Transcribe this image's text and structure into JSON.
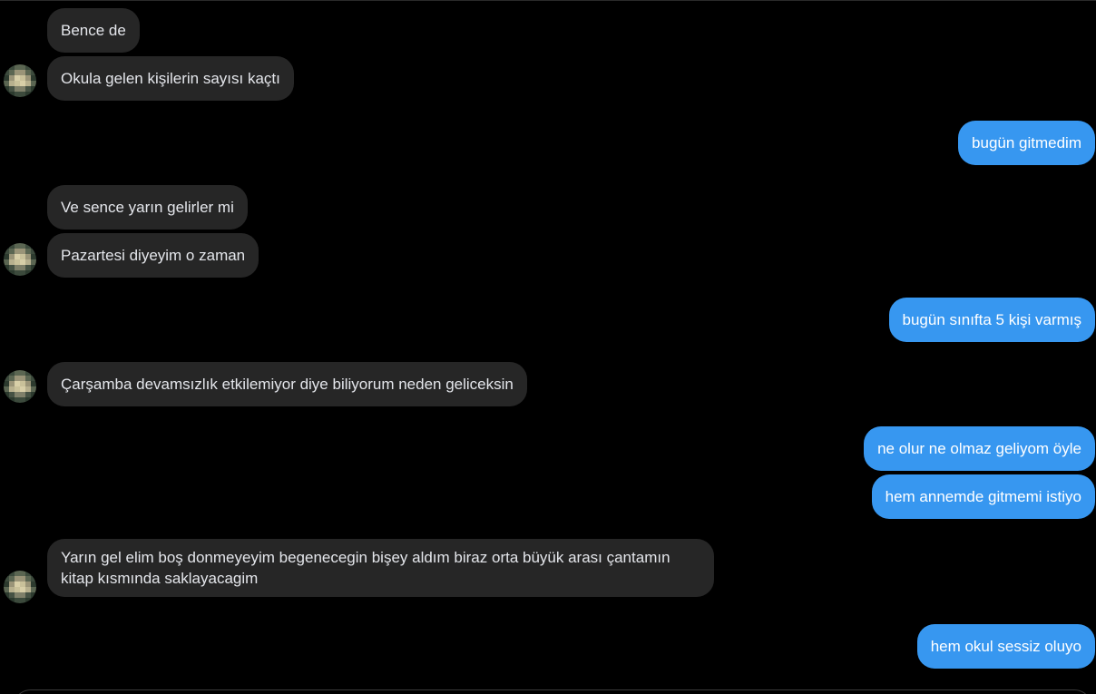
{
  "conversation": {
    "messages": [
      {
        "side": "in",
        "text": "Bence de"
      },
      {
        "side": "in",
        "text": "Okula gelen kişilerin sayısı kaçtı"
      },
      {
        "side": "out",
        "text": "bugün gitmedim"
      },
      {
        "side": "in",
        "text": "Ve sence yarın gelirler mi"
      },
      {
        "side": "in",
        "text": "Pazartesi diyeyim o zaman"
      },
      {
        "side": "out",
        "text": "bugün sınıfta 5 kişi varmış"
      },
      {
        "side": "in",
        "text": "Çarşamba devamsızlık etkilemiyor diye biliyorum neden geliceksin"
      },
      {
        "side": "out",
        "text": "ne olur ne olmaz geliyom öyle"
      },
      {
        "side": "out",
        "text": "hem annemde gitmemi istiyo"
      },
      {
        "side": "in",
        "text": "Yarın gel elim boş donmeyeyim begenecegin bişey aldım biraz orta büyük arası çantamın kitap kısmında saklayacagim"
      },
      {
        "side": "out",
        "text": "hem okul sessiz oluyo"
      }
    ]
  },
  "avatar": {
    "icon": "blurred-profile-avatar"
  },
  "colors": {
    "background": "#000000",
    "incoming_bubble": "#262626",
    "outgoing_bubble": "#3797f0",
    "incoming_text": "#e4e6eb",
    "outgoing_text": "#ffffff"
  }
}
